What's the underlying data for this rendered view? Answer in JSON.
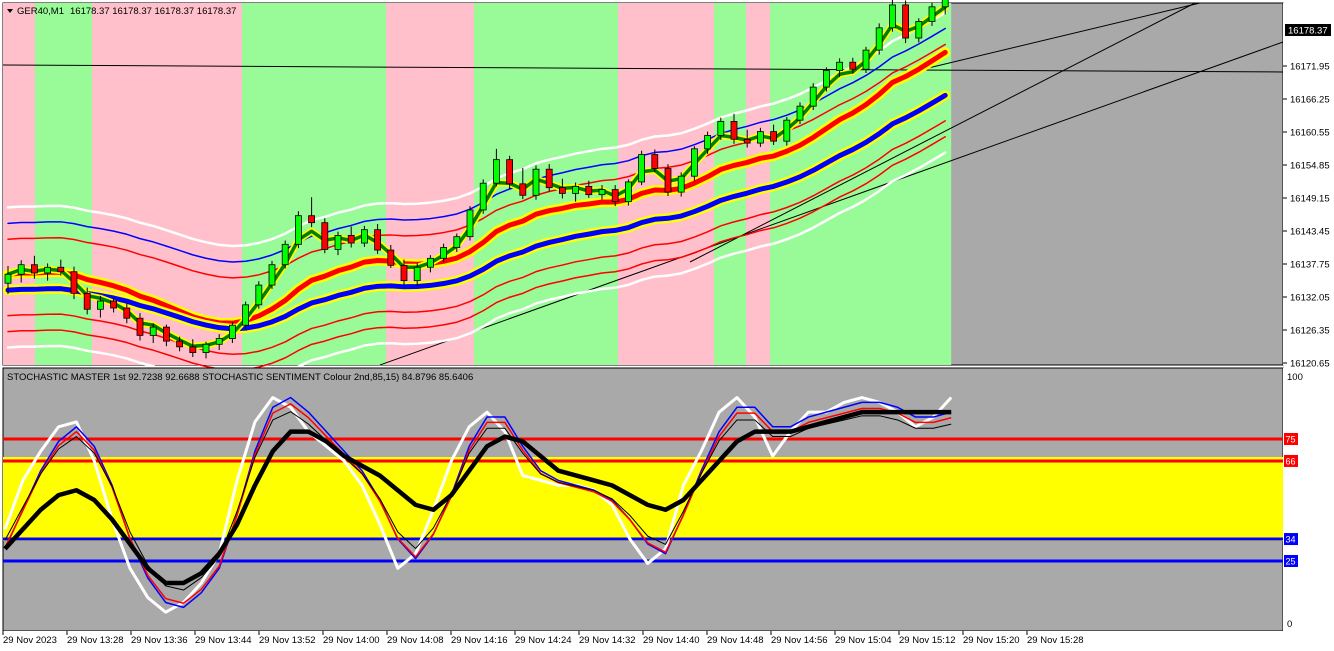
{
  "main_header": {
    "symbol": "GER40,M1",
    "ohlc": "16178.37 16178.37 16178.37 16178.37"
  },
  "price_axis": {
    "labels": [
      "16171.95",
      "16166.25",
      "16160.55",
      "16154.85",
      "16149.15",
      "16143.45",
      "16137.75",
      "16132.05",
      "16126.35",
      "16120.65"
    ],
    "current_price": "16178.37"
  },
  "indicator_header": {
    "text": "STOCHASTIC MASTER 1st 92.7238 92.6688  STOCHASTIC SENTIMENT Colour 2nd,85,15) 84.8796 85.6406"
  },
  "indicator_axis": {
    "top": "100",
    "bottom": "0",
    "level_labels": [
      "75",
      "66",
      "34",
      "25"
    ]
  },
  "time_axis": {
    "labels": [
      "29 Nov 2023",
      "29 Nov 13:28",
      "29 Nov 13:36",
      "29 Nov 13:44",
      "29 Nov 13:52",
      "29 Nov 14:00",
      "29 Nov 14:08",
      "29 Nov 14:16",
      "29 Nov 14:24",
      "29 Nov 14:32",
      "29 Nov 14:40",
      "29 Nov 14:48",
      "29 Nov 14:56",
      "29 Nov 15:04",
      "29 Nov 15:12",
      "29 Nov 15:20",
      "29 Nov 15:28"
    ]
  },
  "colors": {
    "bull_zone": "#98fb98",
    "bear_zone": "#ffc0cb",
    "chart_bg": "#a9a9a9",
    "bull_candle": "#00ff00",
    "bear_candle": "#ff0000",
    "signal_yellow": "#ffff00",
    "mid_blue": "#0000ff",
    "red_band": "#ff0000",
    "white_band": "#ffffff",
    "trend_green": "#008000"
  },
  "icons": {
    "menu": "triangle-down-icon"
  },
  "chart_data": [
    {
      "type": "candlestick",
      "title": "GER40,M1",
      "ylim": [
        16120.65,
        16177.5
      ],
      "ohlc": [
        [
          16133.5,
          16136.2,
          16131.8,
          16134.9
        ],
        [
          16134.9,
          16137.1,
          16133.6,
          16136.4
        ],
        [
          16136.4,
          16137.8,
          16134.2,
          16135.1
        ],
        [
          16135.1,
          16136.6,
          16133.9,
          16136.0
        ],
        [
          16136.0,
          16137.2,
          16134.7,
          16135.3
        ],
        [
          16135.3,
          16136.1,
          16131.0,
          16131.9
        ],
        [
          16131.9,
          16132.8,
          16128.6,
          16129.4
        ],
        [
          16129.4,
          16131.5,
          16128.1,
          16130.7
        ],
        [
          16130.7,
          16131.2,
          16128.9,
          16129.6
        ],
        [
          16129.6,
          16130.4,
          16127.2,
          16128.0
        ],
        [
          16128.0,
          16128.8,
          16124.5,
          16125.3
        ],
        [
          16125.3,
          16127.2,
          16124.1,
          16126.6
        ],
        [
          16126.6,
          16127.0,
          16123.6,
          16124.4
        ],
        [
          16124.4,
          16125.1,
          16122.8,
          16123.5
        ],
        [
          16123.5,
          16124.7,
          16121.9,
          16122.6
        ],
        [
          16122.6,
          16124.3,
          16121.7,
          16123.9
        ],
        [
          16123.9,
          16125.5,
          16123.0,
          16124.8
        ],
        [
          16124.8,
          16127.4,
          16124.1,
          16126.9
        ],
        [
          16126.9,
          16130.6,
          16126.2,
          16130.1
        ],
        [
          16130.1,
          16133.8,
          16129.5,
          16133.2
        ],
        [
          16133.2,
          16137.0,
          16132.6,
          16136.4
        ],
        [
          16136.4,
          16140.2,
          16135.8,
          16139.6
        ],
        [
          16139.6,
          16144.8,
          16139.0,
          16144.1
        ],
        [
          16144.1,
          16147.0,
          16142.3,
          16143.0
        ],
        [
          16143.0,
          16143.7,
          16138.2,
          16138.8
        ],
        [
          16138.8,
          16141.6,
          16137.9,
          16141.0
        ],
        [
          16141.0,
          16142.4,
          16139.1,
          16139.8
        ],
        [
          16139.8,
          16142.5,
          16139.2,
          16141.9
        ],
        [
          16141.9,
          16142.8,
          16138.1,
          16138.7
        ],
        [
          16138.7,
          16139.5,
          16135.9,
          16136.3
        ],
        [
          16136.3,
          16137.2,
          16133.2,
          16133.9
        ],
        [
          16133.9,
          16136.6,
          16133.1,
          16136.0
        ],
        [
          16136.0,
          16137.9,
          16135.2,
          16137.4
        ],
        [
          16137.4,
          16139.7,
          16136.8,
          16139.1
        ],
        [
          16139.1,
          16141.3,
          16138.4,
          16140.8
        ],
        [
          16140.8,
          16145.6,
          16140.2,
          16145.0
        ],
        [
          16145.0,
          16149.8,
          16144.4,
          16149.2
        ],
        [
          16149.2,
          16154.6,
          16148.7,
          16152.9
        ],
        [
          16152.9,
          16153.5,
          16148.3,
          16149.1
        ],
        [
          16149.1,
          16151.6,
          16146.7,
          16147.3
        ],
        [
          16147.3,
          16152.0,
          16146.6,
          16151.4
        ],
        [
          16151.4,
          16152.2,
          16147.9,
          16148.5
        ],
        [
          16148.5,
          16149.9,
          16146.8,
          16147.6
        ],
        [
          16147.6,
          16149.3,
          16146.3,
          16148.7
        ],
        [
          16148.7,
          16149.6,
          16146.9,
          16147.4
        ],
        [
          16147.4,
          16148.9,
          16146.6,
          16148.2
        ],
        [
          16148.2,
          16148.9,
          16145.6,
          16146.3
        ],
        [
          16146.3,
          16149.8,
          16145.7,
          16149.4
        ],
        [
          16149.4,
          16154.3,
          16148.9,
          16153.7
        ],
        [
          16153.7,
          16154.5,
          16150.9,
          16151.5
        ],
        [
          16151.5,
          16152.2,
          16147.2,
          16147.8
        ],
        [
          16147.8,
          16150.9,
          16147.1,
          16150.3
        ],
        [
          16150.3,
          16155.0,
          16149.6,
          16154.6
        ],
        [
          16154.6,
          16157.3,
          16153.8,
          16156.7
        ],
        [
          16156.7,
          16159.5,
          16156.0,
          16158.9
        ],
        [
          16158.9,
          16160.1,
          16155.4,
          16156.1
        ],
        [
          16156.1,
          16157.6,
          16154.8,
          16155.5
        ],
        [
          16155.5,
          16157.9,
          16154.9,
          16157.3
        ],
        [
          16157.3,
          16158.4,
          16155.2,
          16155.8
        ],
        [
          16155.8,
          16159.6,
          16155.1,
          16159.1
        ],
        [
          16159.1,
          16161.9,
          16158.5,
          16161.3
        ],
        [
          16161.3,
          16164.9,
          16160.7,
          16164.3
        ],
        [
          16164.3,
          16167.4,
          16163.6,
          16166.9
        ],
        [
          16166.9,
          16168.8,
          16165.9,
          16168.2
        ],
        [
          16168.2,
          16168.9,
          16166.4,
          16167.1
        ],
        [
          16167.1,
          16170.6,
          16166.5,
          16170.1
        ],
        [
          16170.1,
          16174.3,
          16169.4,
          16173.6
        ],
        [
          16173.6,
          16178.4,
          16173.0,
          16177.2
        ],
        [
          16177.2,
          16177.9,
          16171.2,
          16172.0
        ],
        [
          16172.0,
          16175.1,
          16171.3,
          16174.6
        ],
        [
          16174.6,
          16177.6,
          16173.9,
          16176.9
        ],
        [
          16176.9,
          16178.6,
          16175.7,
          16178.37
        ]
      ]
    },
    {
      "type": "line",
      "title": "STOCHASTIC MASTER 1st 92.7238 92.6688  STOCHASTIC SENTIMENT Colour 2nd,85,15) 84.8796 85.6406",
      "ylim": [
        0,
        100
      ],
      "levels": [
        75,
        66,
        34,
        25
      ],
      "series": [
        {
          "values": [
            38,
            58,
            70,
            80,
            82,
            66,
            42,
            22,
            10,
            4,
            8,
            16,
            28,
            58,
            82,
            92,
            88,
            78,
            72,
            66,
            56,
            40,
            22,
            28,
            46,
            66,
            80,
            86,
            78,
            60,
            58,
            56,
            56,
            54,
            48,
            34,
            24,
            30,
            56,
            70,
            86,
            92,
            84,
            68,
            78,
            86,
            86,
            90,
            92,
            90,
            86,
            80,
            84,
            92
          ]
        },
        {
          "values": [
            30,
            46,
            62,
            74,
            80,
            72,
            56,
            34,
            18,
            8,
            6,
            12,
            22,
            44,
            70,
            88,
            92,
            86,
            78,
            70,
            62,
            50,
            34,
            26,
            36,
            52,
            72,
            84,
            84,
            72,
            62,
            58,
            56,
            54,
            50,
            42,
            32,
            28,
            44,
            62,
            78,
            88,
            88,
            80,
            80,
            84,
            86,
            88,
            90,
            90,
            88,
            84,
            84,
            86
          ]
        },
        {
          "values": [
            30,
            38,
            46,
            52,
            54,
            50,
            42,
            32,
            22,
            16,
            16,
            20,
            28,
            40,
            56,
            70,
            78,
            78,
            74,
            68,
            64,
            60,
            54,
            48,
            46,
            52,
            62,
            72,
            76,
            74,
            68,
            62,
            60,
            58,
            56,
            52,
            48,
            46,
            50,
            58,
            66,
            74,
            78,
            78,
            78,
            80,
            82,
            84,
            86,
            86,
            86,
            86,
            86,
            86
          ]
        }
      ]
    }
  ]
}
